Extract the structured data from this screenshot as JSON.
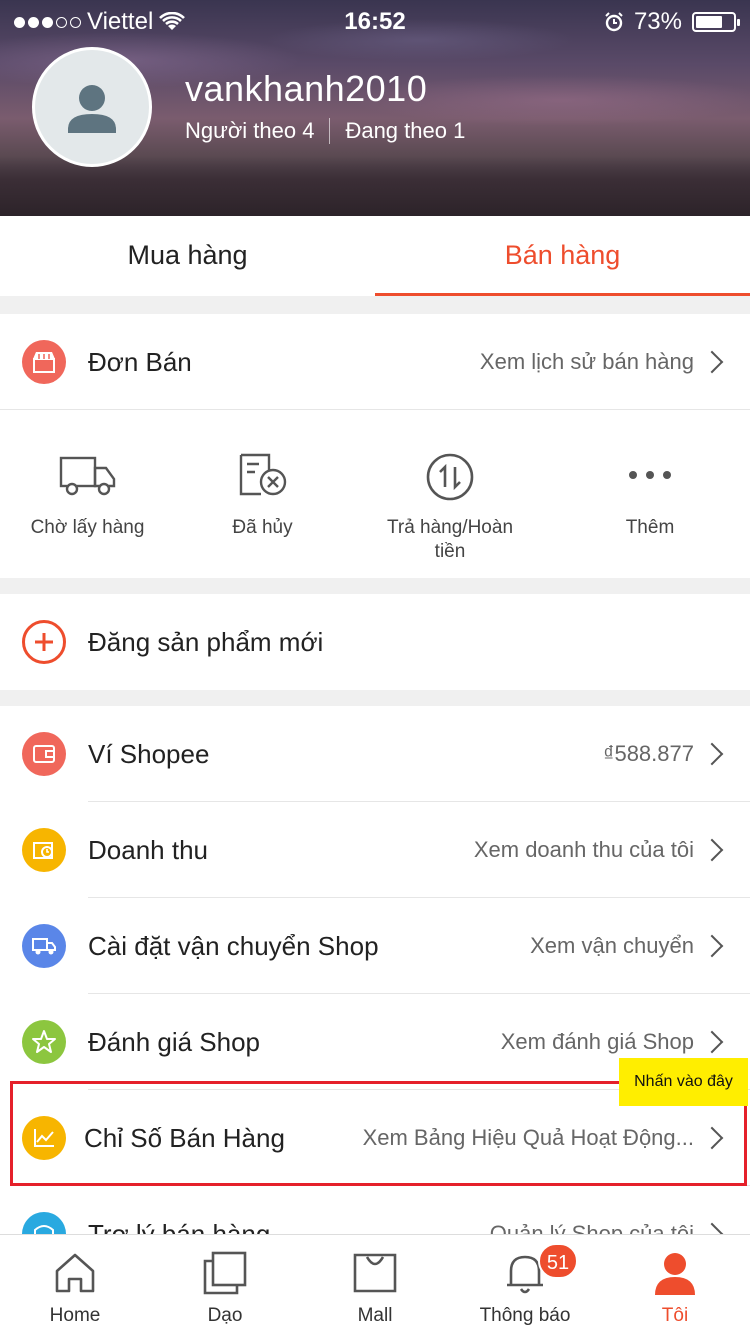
{
  "status_bar": {
    "carrier": "Viettel",
    "time": "16:52",
    "battery": "73%",
    "battery_level": 0.73
  },
  "profile": {
    "username": "vankhanh2010",
    "followers": "Người theo 4",
    "following": "Đang theo 1"
  },
  "tabs": [
    "Mua hàng",
    "Bán hàng"
  ],
  "don_ban": {
    "title": "Đơn Bán",
    "right": "Xem lịch sử bán hàng"
  },
  "order_status": [
    {
      "label": "Chờ lấy hàng",
      "icon": "truck-icon"
    },
    {
      "label": "Đã hủy",
      "icon": "cancelled-order-icon"
    },
    {
      "label": "Trả hàng/Hoàn tiền",
      "icon": "return-refund-icon"
    },
    {
      "label": "Thêm",
      "icon": "more-dots-icon"
    }
  ],
  "new_product": {
    "label": "Đăng sản phẩm mới"
  },
  "menu": [
    {
      "title": "Ví Shopee",
      "right": "₫588.877",
      "icon": "wallet-icon",
      "color": "#f0675b"
    },
    {
      "title": "Doanh thu",
      "right": "Xem doanh thu của tôi",
      "icon": "revenue-icon",
      "color": "#f7b500"
    },
    {
      "title": "Cài đặt vận chuyển Shop",
      "right": "Xem vận chuyển",
      "icon": "shipping-icon",
      "color": "#5a86e8"
    },
    {
      "title": "Đánh giá Shop",
      "right": "Xem đánh giá Shop",
      "icon": "star-icon",
      "color": "#8cc63f"
    },
    {
      "title": "Chỉ Số Bán Hàng",
      "right": "Xem Bảng Hiệu Quả Hoạt Động...",
      "icon": "chart-icon",
      "color": "#f7b500"
    },
    {
      "title": "Trợ lý bán hàng",
      "right": "Quản lý Shop của tôi",
      "icon": "assistant-icon",
      "color": "#29a9e0"
    }
  ],
  "tooltip": "Nhấn vào đây",
  "bottom_nav": [
    {
      "label": "Home",
      "icon": "home-icon"
    },
    {
      "label": "Dạo",
      "icon": "feed-icon"
    },
    {
      "label": "Mall",
      "icon": "mall-bag-icon"
    },
    {
      "label": "Thông báo",
      "icon": "bell-icon",
      "badge": "51"
    },
    {
      "label": "Tôi",
      "icon": "profile-icon"
    }
  ],
  "colors": {
    "accent": "#ee4d2d",
    "highlight_border": "#e5202a",
    "tooltip_bg": "#ffee00"
  }
}
